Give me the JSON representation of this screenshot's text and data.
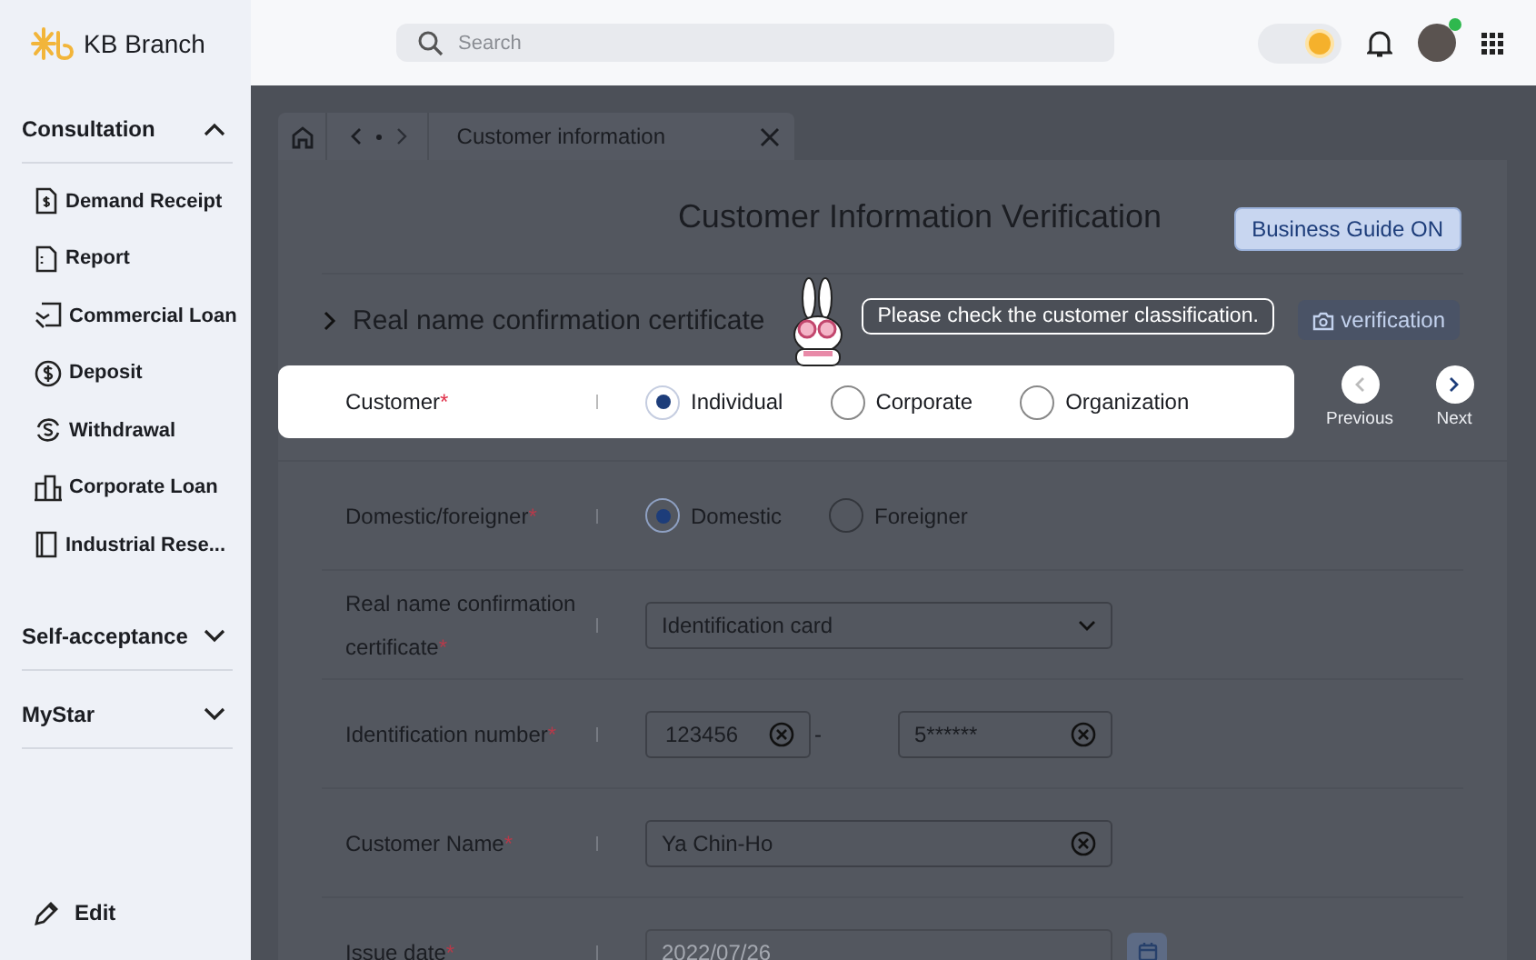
{
  "app": {
    "title": "KB Branch"
  },
  "search": {
    "placeholder": "Search"
  },
  "theme_toggle": {
    "on": true
  },
  "sidebar": {
    "groups": [
      {
        "label": "Consultation",
        "expanded": true,
        "items": [
          {
            "label": "Demand Receipt"
          },
          {
            "label": "Report"
          },
          {
            "label": "Commercial Loan"
          },
          {
            "label": "Deposit"
          },
          {
            "label": "Withdrawal"
          },
          {
            "label": "Corporate Loan"
          },
          {
            "label": "Industrial Rese..."
          }
        ]
      },
      {
        "label": "Self-acceptance",
        "expanded": false
      },
      {
        "label": "MyStar",
        "expanded": false
      }
    ],
    "edit": "Edit"
  },
  "tab": {
    "label": "Customer information"
  },
  "page": {
    "title": "Customer Information Verification",
    "guide_button": "Business Guide ON"
  },
  "section": {
    "title": "Real name confirmation certificate",
    "verify_button": "verification",
    "tooltip": "Please check the customer classification."
  },
  "fields": [
    {
      "kind": "radio",
      "label": "Customer",
      "mark": "*",
      "highlighted": true,
      "options": [
        {
          "label": "Individual",
          "selected": true
        },
        {
          "label": "Corporate",
          "selected": false
        },
        {
          "label": "Organization",
          "selected": false
        }
      ]
    },
    {
      "kind": "radio",
      "label": "Domestic/foreigner",
      "mark": "*",
      "highlighted": false,
      "options": [
        {
          "label": "Domestic",
          "selected": true
        },
        {
          "label": "Foreigner",
          "selected": false
        }
      ]
    },
    {
      "kind": "select",
      "label": "Real name confirmation certificate",
      "mark": "*",
      "highlighted": false,
      "value": "Identification card"
    },
    {
      "kind": "split",
      "label": "Identification number",
      "mark": "*",
      "highlighted": false,
      "values": [
        "123456",
        "5******"
      ],
      "separator": "-"
    },
    {
      "kind": "text",
      "label": "Customer Name",
      "mark": "*",
      "highlighted": false,
      "value": "Ya Chin-Ho"
    },
    {
      "kind": "date",
      "label": "Issue date",
      "mark": "*",
      "highlighted": false,
      "value": "2022/07/26",
      "disabled": true
    }
  ],
  "nav": {
    "previous": {
      "label": "Previous",
      "disabled": true
    },
    "next": {
      "label": "Next",
      "disabled": false
    }
  }
}
